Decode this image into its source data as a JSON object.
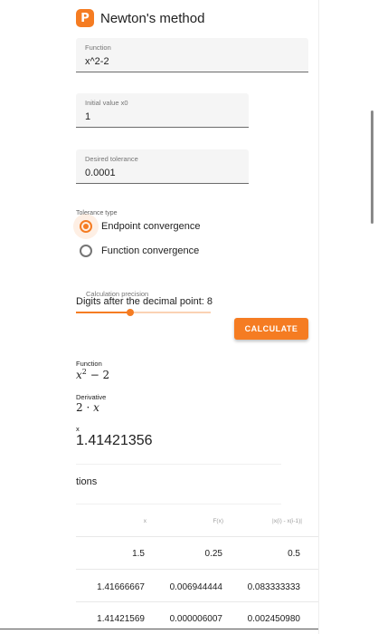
{
  "header": {
    "logo_letter": "P",
    "title": "Newton's method"
  },
  "function_field": {
    "label": "Function",
    "value": "x^2-2"
  },
  "initial_field": {
    "label": "Initial value x0",
    "value": "1"
  },
  "tolerance_field": {
    "label": "Desired tolerance",
    "value": "0.0001"
  },
  "tolerance_type": {
    "label": "Tolerance type",
    "options": [
      {
        "label": "Endpoint convergence",
        "selected": true
      },
      {
        "label": "Function convergence",
        "selected": false
      }
    ]
  },
  "precision": {
    "caption": "Calculation precision",
    "text": "Digits after the decimal point: 8",
    "level_fraction": 0.4
  },
  "calculate_button": {
    "label": "CALCULATE"
  },
  "results": {
    "function_label": "Function",
    "derivative_label": "Derivative",
    "x_label": "x",
    "x_value": "1.41421356",
    "iterations_partial": "tions"
  },
  "table": {
    "headers": [
      "x",
      "F(x)",
      "|x(i) - x(i-1)|"
    ],
    "rows": [
      [
        "1.5",
        "0.25",
        "0.5"
      ],
      [
        "1.41666667",
        "0.006944444",
        "0.083333333"
      ],
      [
        "1.41421569",
        "0.000006007",
        "0.002450980"
      ]
    ]
  },
  "colors": {
    "accent": "#f57c22",
    "text": "#212121",
    "muted": "#757575"
  }
}
